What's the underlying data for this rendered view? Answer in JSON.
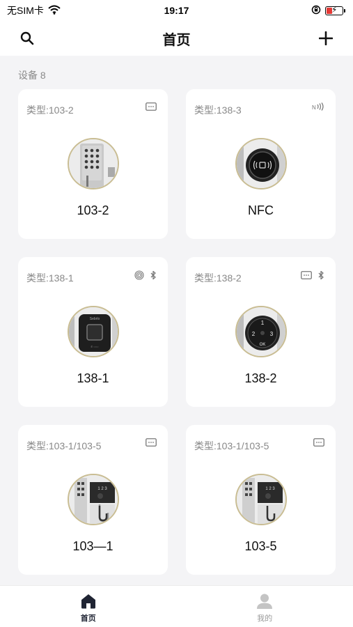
{
  "status_bar": {
    "carrier": "无SIM卡",
    "time": "19:17"
  },
  "header": {
    "title": "首页",
    "search_icon": "search-icon",
    "add_icon": "plus-icon"
  },
  "section": {
    "label": "设备 8"
  },
  "devices": [
    {
      "type": "类型:103-2",
      "name": "103-2",
      "icons": [
        "keypad-icon"
      ],
      "image": "keypad-lock"
    },
    {
      "type": "类型:138-3",
      "name": "NFC",
      "icons": [
        "nfc-icon"
      ],
      "image": "nfc-lock"
    },
    {
      "type": "类型:138-1",
      "name": "138-1",
      "icons": [
        "fingerprint-icon",
        "bluetooth-icon"
      ],
      "image": "fingerprint-lock"
    },
    {
      "type": "类型:138-2",
      "name": "138-2",
      "icons": [
        "keypad-icon",
        "bluetooth-icon"
      ],
      "image": "dial-lock"
    },
    {
      "type": "类型:103-1/103-5",
      "name": "103—1",
      "icons": [
        "keypad-icon"
      ],
      "image": "side-keypad-lock"
    },
    {
      "type": "类型:103-1/103-5",
      "name": "103-5",
      "icons": [
        "keypad-icon"
      ],
      "image": "side-keypad-lock"
    }
  ],
  "tab_bar": {
    "home": "首页",
    "mine": "我的"
  },
  "colors": {
    "tab_active": "#1f2433",
    "tab_inactive": "#c4c4c4",
    "image_ring": "#c9bd93"
  }
}
